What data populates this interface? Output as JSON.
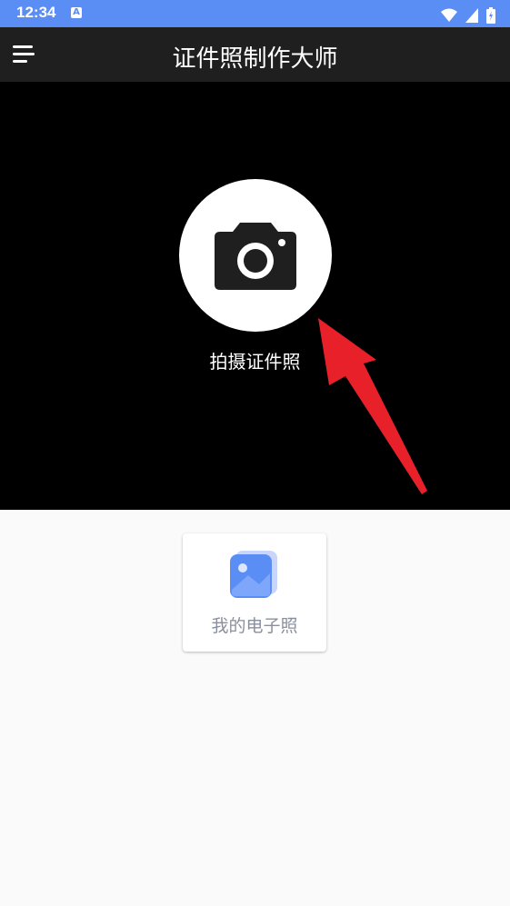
{
  "status_bar": {
    "time": "12:34",
    "notification_badge": "A"
  },
  "app_bar": {
    "title": "证件照制作大师",
    "menu_icon": "hamburger-menu-icon"
  },
  "camera": {
    "label": "拍摄证件照",
    "icon": "camera-icon"
  },
  "gallery_card": {
    "label": "我的电子照",
    "icon": "photo-stack-icon"
  },
  "colors": {
    "status_bar": "#5b8ef5",
    "app_bar": "#1f1f20",
    "camera_panel": "#000000",
    "arrow": "#e8202a",
    "gallery_icon": "#5b8ef5",
    "card_label": "#8a8f9e"
  }
}
